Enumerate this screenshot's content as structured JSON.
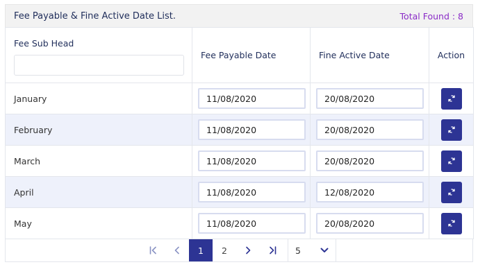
{
  "header": {
    "title": "Fee Payable & Fine Active Date List.",
    "total_found": "Total Found : 8"
  },
  "columns": {
    "sub_head": "Fee Sub Head",
    "payable_date": "Fee Payable Date",
    "fine_date": "Fine Active Date",
    "action": "Action"
  },
  "search": {
    "value": "",
    "placeholder": ""
  },
  "rows": [
    {
      "month": "January",
      "payable": "11/08/2020",
      "fine": "20/08/2020"
    },
    {
      "month": "February",
      "payable": "11/08/2020",
      "fine": "20/08/2020"
    },
    {
      "month": "March",
      "payable": "11/08/2020",
      "fine": "20/08/2020"
    },
    {
      "month": "April",
      "payable": "11/08/2020",
      "fine": "12/08/2020"
    },
    {
      "month": "May",
      "payable": "11/08/2020",
      "fine": "20/08/2020"
    }
  ],
  "pagination": {
    "current_page": "1",
    "next_page": "2",
    "page_size": "5"
  },
  "icons": {
    "action": "refresh-icon",
    "first": "first-page-icon",
    "prev": "prev-page-icon",
    "next": "next-page-icon",
    "last": "last-page-icon",
    "size": "chevron-down-icon"
  },
  "colors": {
    "accent": "#2d3494",
    "total_found": "#8a2bc7",
    "row_alt": "#eef1fb",
    "header_bg": "#f2f2f2"
  }
}
